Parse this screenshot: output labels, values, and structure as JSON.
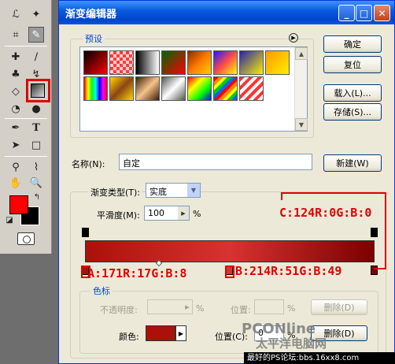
{
  "dialog": {
    "title": "渐变编辑器",
    "buttons": {
      "ok": "确定",
      "reset": "复位",
      "load": "载入(L)...",
      "save": "存储(S)...",
      "new": "新建(W)"
    }
  },
  "presets": {
    "label": "预设",
    "swatches": [
      {
        "css": "linear-gradient(135deg,#000,#ff0000)"
      },
      {
        "css": "repeating-conic-gradient(#ff3b3b 0 25%, #ffd0d0 0 50%) 0 0/8px 8px"
      },
      {
        "css": "linear-gradient(to right,#000,#fff)"
      },
      {
        "css": "linear-gradient(135deg,#006600,#ff0000)"
      },
      {
        "css": "linear-gradient(135deg,#8b2a00,#ff7a00,#ffd000)"
      },
      {
        "css": "linear-gradient(135deg,#1a1aff,#ff4a4a,#ffff00)"
      },
      {
        "css": "linear-gradient(135deg,#2222aa,#ffee00)"
      },
      {
        "css": "linear-gradient(135deg,#ff9900,#ffee00)"
      },
      {
        "css": "linear-gradient(to right,#ff0000,#ffff00,#00ff00,#00ffff,#0000ff,#ff00ff,#ff0000)"
      },
      {
        "css": "linear-gradient(135deg,#ffd700,#8b4513,#ffd700)"
      },
      {
        "css": "linear-gradient(135deg,#3b1d0c,#f5c48a,#3b1d0c)"
      },
      {
        "css": "linear-gradient(135deg,#555,#fff,#555)"
      },
      {
        "css": "linear-gradient(135deg,#ff0000,#ffff00,#00ff00,#0000ff)"
      },
      {
        "css": "repeating-linear-gradient(135deg,#ff0000 0 4px,#ff8800 4px 8px,#ffff00 8px 12px,#00cc00 12px 16px,#0066ff 16px 20px)"
      },
      {
        "css": "repeating-linear-gradient(135deg,#ff3333 0 4px,#fff 4px 8px)"
      }
    ]
  },
  "name": {
    "label": "名称(N):",
    "value": "自定"
  },
  "gradient": {
    "group_label": "渐变类型(T):",
    "type_value": "实底",
    "smoothness_label": "平滑度(M):",
    "smoothness_value": "100",
    "smoothness_unit": "%"
  },
  "color_stops": {
    "group_label": "色标",
    "opacity_label": "不透明度:",
    "opacity_unit": "%",
    "location_label1": "位置:",
    "location_unit1": "%",
    "delete1": "删除(D)",
    "color_label": "颜色:",
    "location_label2": "位置(C):",
    "location_value2": "0",
    "location_unit2": "%",
    "delete2": "删除(D)"
  },
  "annotations": {
    "stop_a": "A:171R:17G:B:8",
    "stop_b": "B:214R:51G:B:49",
    "stop_c": "C:124R:0G:B:0"
  },
  "colors": {
    "stop_a": "#ab1108",
    "stop_b": "#d63331",
    "stop_c": "#7c0000",
    "foreground": "#ff0000",
    "accent": "#e00000"
  },
  "watermark": {
    "line1": "PCONline",
    "line2": "太平洋电脑网"
  },
  "footer": "最好的PS论坛:bbs.16xx8.com"
}
